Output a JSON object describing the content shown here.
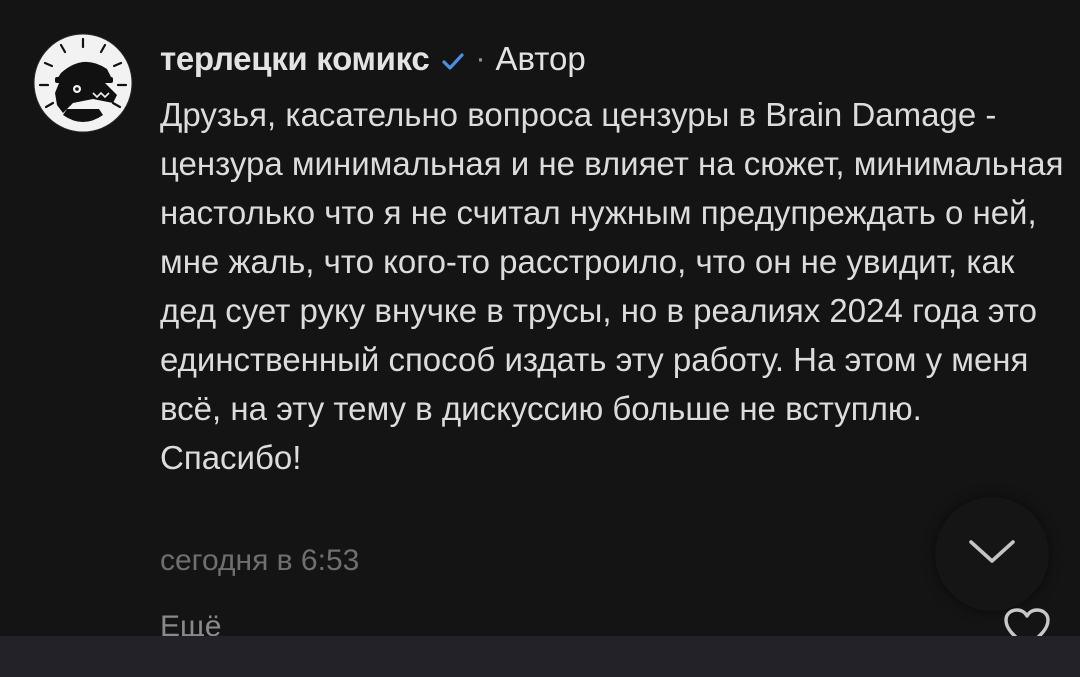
{
  "comment": {
    "author": "терлецки комикс",
    "verified_icon": "checkmark-icon",
    "separator": "·",
    "role": "Автор",
    "text": "Друзья, касательно вопроса цензуры в Brain Damage - цензура минимальная и не влияет на сюжет, минимальная настолько что я не считал нужным предупреждать о ней, мне жаль, что кого-то расстроило, что он не увидит, как дед сует руку внучке в трусы, но в реалиях 2024 года это единственный способ издать эту работу. На этом у меня всё, на эту тему в дискуссию больше не вступлю. Спасибо!",
    "timestamp": "сегодня в 6:53",
    "more_label": "Ещё"
  },
  "icons": {
    "scroll_down": "chevron-down-icon",
    "like": "heart-icon",
    "more": "chevron-down-icon"
  },
  "colors": {
    "background": "#141414",
    "text": "#dcdcdc",
    "muted": "#6f6f6f",
    "verified": "#4a8fe0",
    "bottom_bar": "#232229"
  }
}
